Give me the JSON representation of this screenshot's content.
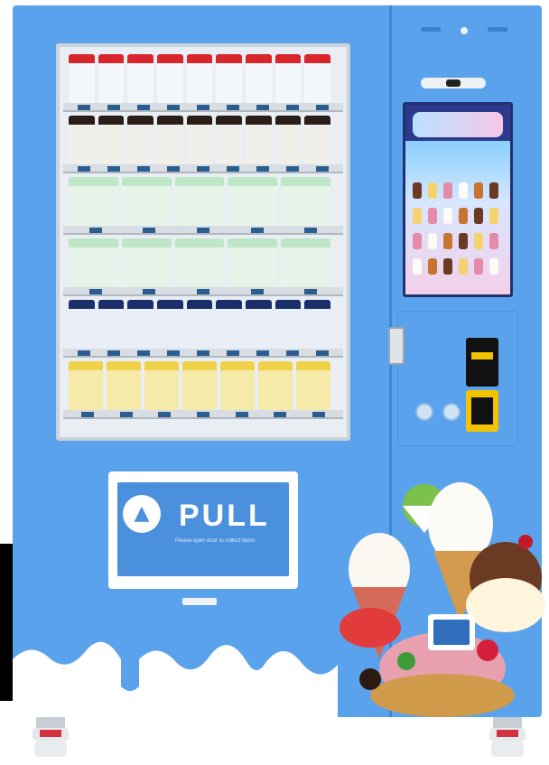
{
  "door": {
    "pull_label": "PULL",
    "pull_subtext": "Please open door to collect items",
    "pull_icon": "ice-cream-icon"
  },
  "colors": {
    "machine_body": "#5aa3ec",
    "pull_panel": "#4a90dd",
    "card_reader": "#f2c400"
  },
  "icons": {
    "bill_acceptor": "bill-acceptor-icon",
    "card_reader": "card-reader-icon",
    "camera": "camera-icon"
  }
}
